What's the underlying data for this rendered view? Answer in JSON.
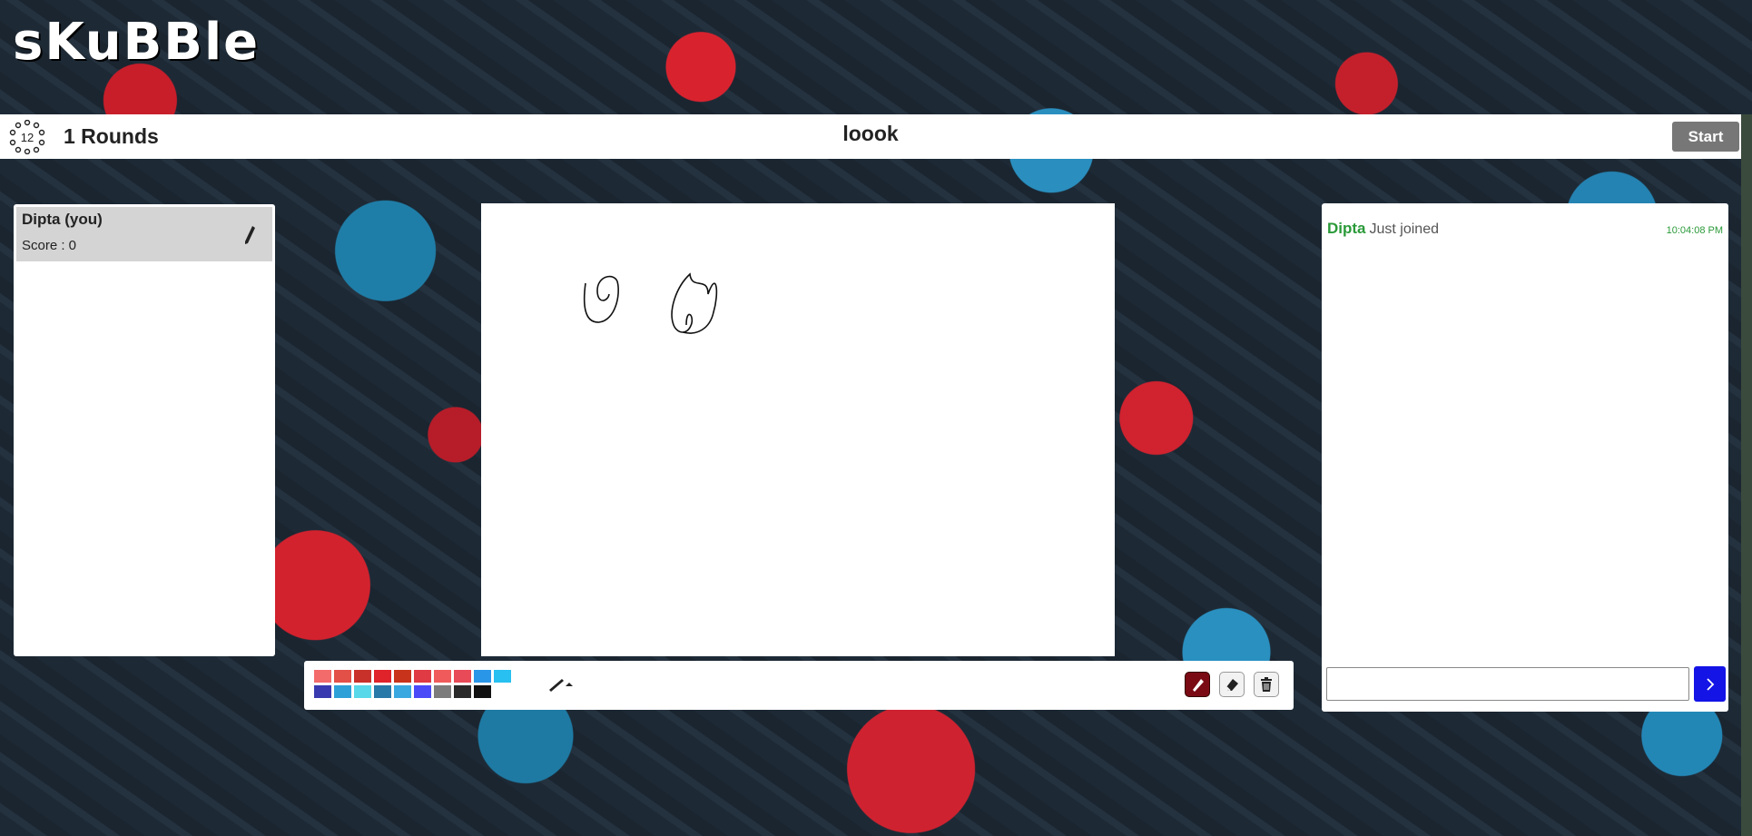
{
  "app": {
    "logo": "sKuBBle"
  },
  "header": {
    "round_icon_number": "12",
    "rounds_label": "1 Rounds",
    "word": "loook",
    "start_label": "Start"
  },
  "players": [
    {
      "name": "Dipta (you)",
      "score": "Score : 0",
      "drawing_icon": "pen-icon"
    }
  ],
  "toolbar": {
    "palette": [
      "#f36b6b",
      "#e25048",
      "#c8312a",
      "#e0222a",
      "#c8341b",
      "#e03a44",
      "#f05a5a",
      "#e84a58",
      "#2a96e8",
      "#28c0f0",
      "#3a3ab0",
      "#2ea0d8",
      "#58d8e8",
      "#2878a8",
      "#3aa8e0",
      "#4a4af8",
      "#7c7c7c",
      "#2a2a2a",
      "#111111",
      ""
    ],
    "brush_icon": "brush-size-icon",
    "tools": [
      "pencil-icon",
      "eraser-icon",
      "trash-icon"
    ]
  },
  "chat": {
    "messages": [
      {
        "name": "Dipta",
        "text": "Just joined",
        "time": "10:04:08 PM"
      }
    ],
    "input_value": "",
    "send_icon": "chevron-right-icon"
  },
  "colors": {
    "accent": "#1414e6",
    "join_green": "#2a9a38",
    "active_tool": "#7a0a14"
  }
}
